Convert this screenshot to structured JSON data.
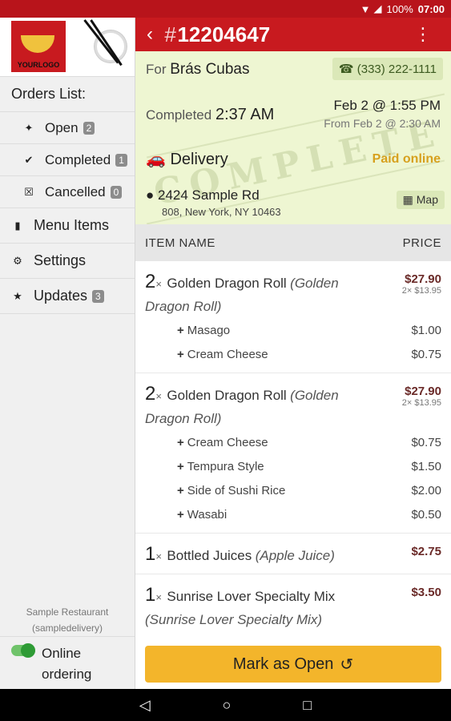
{
  "status_bar": {
    "battery": "100%",
    "time": "07:00"
  },
  "sidebar": {
    "logo_text": "YOURLOGO",
    "orders_heading": "Orders List:",
    "orders": [
      {
        "label": "Open",
        "count": "2",
        "icon": "pin-icon"
      },
      {
        "label": "Completed",
        "count": "1",
        "icon": "check-icon"
      },
      {
        "label": "Cancelled",
        "count": "0",
        "icon": "x-box-icon"
      }
    ],
    "main_items": [
      {
        "label": "Menu Items",
        "icon": "book-icon",
        "count": ""
      },
      {
        "label": "Settings",
        "icon": "gear-icon",
        "count": ""
      },
      {
        "label": "Updates",
        "icon": "star-icon",
        "count": "3"
      }
    ],
    "restaurant_name": "Sample Restaurant",
    "restaurant_handle": "(sampledelivery)",
    "online_label_1": "Online",
    "online_label_2": "ordering"
  },
  "header": {
    "hash": "#",
    "order_number": "12204647"
  },
  "order": {
    "for_label": "For",
    "customer": "Brás Cubas",
    "phone": "(333) 222-1111",
    "completed_label": "Completed",
    "completed_time": "2:37 AM",
    "date": "Feb 2 @ 1:55 PM",
    "from_date": "From Feb 2 @ 2:30 AM",
    "stamp": "COMPLETE",
    "delivery_label": "Delivery",
    "payment": "Paid online",
    "address_line1": "2424 Sample Rd",
    "address_line2": "808, New York, NY 10463",
    "map_label": "Map"
  },
  "table": {
    "col_name": "ITEM NAME",
    "col_price": "PRICE"
  },
  "items": [
    {
      "qty": "2",
      "x": "×",
      "name": "Golden Dragon Roll",
      "option": "(Golden Dragon Roll)",
      "price": "$27.90",
      "each": "2× $13.95",
      "mods": [
        {
          "label": "Masago",
          "price": "$1.00"
        },
        {
          "label": "Cream Cheese",
          "price": "$0.75"
        }
      ]
    },
    {
      "qty": "2",
      "x": "×",
      "name": "Golden Dragon Roll",
      "option": "(Golden Dragon Roll)",
      "price": "$27.90",
      "each": "2× $13.95",
      "mods": [
        {
          "label": "Cream Cheese",
          "price": "$0.75"
        },
        {
          "label": "Tempura Style",
          "price": "$1.50"
        },
        {
          "label": "Side of Sushi Rice",
          "price": "$2.00"
        },
        {
          "label": "Wasabi",
          "price": "$0.50"
        }
      ]
    },
    {
      "qty": "1",
      "x": "×",
      "name": "Bottled Juices",
      "option": "(Apple Juice)",
      "price": "$2.75",
      "each": "",
      "mods": []
    },
    {
      "qty": "1",
      "x": "×",
      "name": "Sunrise Lover Specialty Mix",
      "option": "(Sunrise Lover Specialty Mix)",
      "price": "$3.50",
      "each": "",
      "mods": []
    }
  ],
  "cta": {
    "label": "Mark as Open"
  }
}
